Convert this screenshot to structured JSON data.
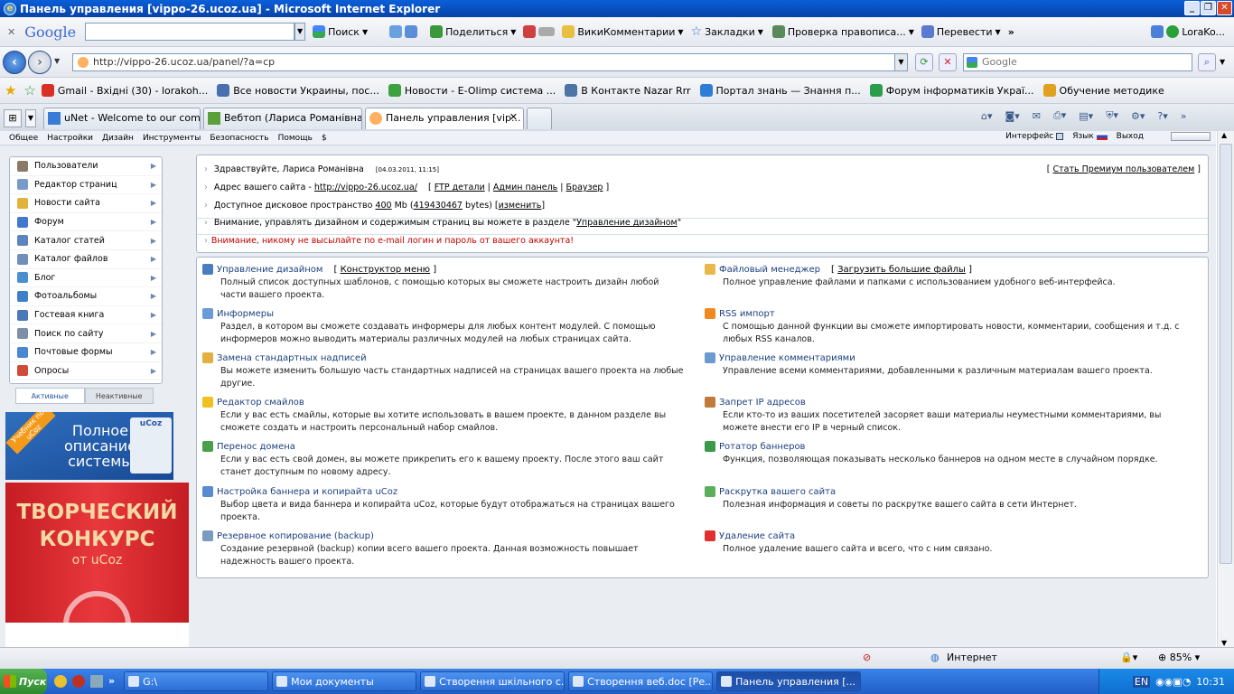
{
  "window": {
    "title": "Панель управления [vippo-26.ucoz.ua] - Microsoft Internet Explorer"
  },
  "google_toolbar": {
    "logo": "Google",
    "search_button": "Поиск",
    "share": "Поделиться",
    "wiki": "ВикиКомментарии",
    "bookmarks": "Закладки",
    "spellcheck": "Проверка правописа...",
    "translate": "Перевести",
    "user": "LoraKo..."
  },
  "address": {
    "url": "http://vippo-26.ucoz.ua/panel/?a=cp",
    "search_placeholder": "Google"
  },
  "favorites": [
    {
      "label": "Gmail - Вхідні (30) - lorakoh...",
      "color": "#d93025"
    },
    {
      "label": "Все новости Украины, пос...",
      "color": "#4a6fae"
    },
    {
      "label": "Новости - E-Olimp система ...",
      "color": "#3fa03f"
    },
    {
      "label": "В Контакте  Nazar Rrr",
      "color": "#4c75a3"
    },
    {
      "label": "Портал знань — Знання п...",
      "color": "#2e7cd8"
    },
    {
      "label": "Форум інформатиків Украї...",
      "color": "#2a9d4b"
    },
    {
      "label": "Обучение методике",
      "color": "#e0a020"
    }
  ],
  "tabs": [
    {
      "label": "uNet - Welcome to our comm...",
      "color": "#3a7bd5"
    },
    {
      "label": "Вебтоп (Лариса Романівна)",
      "color": "#5aa03a"
    },
    {
      "label": "Панель управления [vip...",
      "color": "#ffb060"
    }
  ],
  "menu": {
    "items": [
      "Общее",
      "Настройки",
      "Дизайн",
      "Инструменты",
      "Безопасность",
      "Помощь",
      "$"
    ],
    "interface": "Интерфейс",
    "language": "Язык",
    "logout": "Выход"
  },
  "sidebar": {
    "items": [
      {
        "label": "Пользователи",
        "color": "#8a7a6a"
      },
      {
        "label": "Редактор страниц",
        "color": "#7a9ac8"
      },
      {
        "label": "Новости сайта",
        "color": "#e2b33a"
      },
      {
        "label": "Форум",
        "color": "#3f7ad0"
      },
      {
        "label": "Каталог статей",
        "color": "#5a85c0"
      },
      {
        "label": "Каталог файлов",
        "color": "#6f8fb8"
      },
      {
        "label": "Блог",
        "color": "#4a90d0"
      },
      {
        "label": "Фотоальбомы",
        "color": "#3d7fc9"
      },
      {
        "label": "Гостевая книга",
        "color": "#4a78b8"
      },
      {
        "label": "Поиск по сайту",
        "color": "#7f8fa8"
      },
      {
        "label": "Почтовые формы",
        "color": "#4a86d2"
      },
      {
        "label": "Опросы",
        "color": "#d04a3a"
      }
    ],
    "tab_active": "Активные",
    "tab_inactive": "Неактивные",
    "banner1_title": "Полное описание системы",
    "banner1_ribbon": "Учебник по uCoz",
    "banner1_logo": "uCoz",
    "banner2_title": "ТВОРЧЕСКИЙ КОНКУРС",
    "banner2_sub": "от uCoz"
  },
  "info": {
    "greeting": "Здравствуйте, Лариса Романівна",
    "datetime": "[04.03.2011, 11:15]",
    "premium": "Стать Премиум пользователем",
    "address_label": "Адрес вашего сайта -",
    "site_url": "http://vippo-26.ucoz.ua/",
    "ftp": "FTP детали",
    "admin": "Админ панель",
    "browser": "Браузер",
    "disk_label": "Доступное дисковое пространство",
    "disk_mb": "400",
    "disk_unit": "Mb",
    "disk_bytes": "419430467",
    "bytes_unit": "bytes)",
    "change": "изменить",
    "design_note": "Внимание, управлять дизайном и содержимым страниц вы можете в разделе \"",
    "design_link": "Управление дизайном",
    "warning": "Внимание, никому не высылайте по e-mail логин и пароль от вашего аккаунта!"
  },
  "features_left": [
    {
      "title": "Управление дизайном",
      "extra": "Конструктор меню",
      "desc": "Полный список доступных шаблонов, с помощью которых вы сможете настроить дизайн любой части вашего проекта.",
      "color": "#4a7cc0"
    },
    {
      "title": "Информеры",
      "extra": "",
      "desc": "Раздел, в котором вы сможете создавать информеры для любых контент модулей. С помощью информеров можно выводить материалы различных модулей на любых страницах сайта.",
      "color": "#6a9ad8"
    },
    {
      "title": "Замена стандартных надписей",
      "extra": "",
      "desc": "Вы можете изменить большую часть стандартных надписей на страницах вашего проекта на любые другие.",
      "color": "#e0b040"
    },
    {
      "title": "Редактор смайлов",
      "extra": "",
      "desc": "Если у вас есть смайлы, которые вы хотите использовать в вашем проекте, в данном разделе вы сможете создать и настроить персональный набор смайлов.",
      "color": "#f0c020"
    },
    {
      "title": "Перенос домена",
      "extra": "",
      "desc": "Если у вас есть свой домен, вы можете прикрепить его к вашему проекту. После этого ваш сайт станет доступным по новому адресу.",
      "color": "#4aa04a"
    },
    {
      "title": "Настройка баннера и копирайта uCoz",
      "extra": "",
      "desc": "Выбор цвета и вида баннера и копирайта uCoz, которые будут отображаться на страницах вашего проекта.",
      "color": "#5a8ad0"
    },
    {
      "title": "Резервное копирование (backup)",
      "extra": "",
      "desc": "Создание резервной (backup) копии всего вашего проекта. Данная возможность повышает надежность вашего проекта.",
      "color": "#7a9ac0"
    }
  ],
  "features_right": [
    {
      "title": "Файловый менеджер",
      "extra": "Загрузить большие файлы",
      "desc": "Полное управление файлами и папками с использованием удобного веб-интерфейса.",
      "color": "#e8b84a"
    },
    {
      "title": "RSS импорт",
      "extra": "",
      "desc": "С помощью данной функции вы сможете импортировать новости, комментарии, сообщения и т.д. с любых RSS каналов.",
      "color": "#f08a20"
    },
    {
      "title": "Управление комментариями",
      "extra": "",
      "desc": "Управление всеми комментариями, добавленными к различным материалам вашего проекта.",
      "color": "#6a9ad0"
    },
    {
      "title": "Запрет IP адресов",
      "extra": "",
      "desc": "Если кто-то из ваших посетителей засоряет ваши материалы неуместными комментариями, вы можете внести его IP в черный список.",
      "color": "#c07a3a"
    },
    {
      "title": "Ротатор баннеров",
      "extra": "",
      "desc": "Функция, позволяющая показывать несколько баннеров на одном месте в случайном порядке.",
      "color": "#3a9a4a"
    },
    {
      "title": "Раскрутка вашего сайта",
      "extra": "",
      "desc": "Полезная информация и советы по раскрутке вашего сайта в сети Интернет.",
      "color": "#5ab05a"
    },
    {
      "title": "Удаление сайта",
      "extra": "",
      "desc": "Полное удаление вашего сайта и всего, что с ним связано.",
      "color": "#e03030"
    }
  ],
  "status": {
    "zone": "Интернет",
    "zoom": "85%"
  },
  "taskbar": {
    "start": "Пуск",
    "tasks": [
      {
        "label": "G:\\",
        "active": false
      },
      {
        "label": "Мои документы",
        "active": false
      },
      {
        "label": "Створення шкільного с...",
        "active": false
      },
      {
        "label": "Створення веб.doc [Ре...",
        "active": false
      },
      {
        "label": "Панель управления [...",
        "active": true
      }
    ],
    "lang": "EN",
    "clock": "10:31"
  }
}
